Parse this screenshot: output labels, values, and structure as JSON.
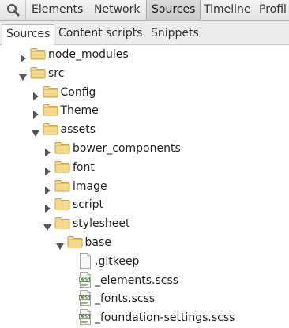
{
  "toolbar": {
    "search_icon": "magnifier-icon",
    "tabs": [
      {
        "label": "Elements"
      },
      {
        "label": "Network"
      },
      {
        "label": "Sources"
      },
      {
        "label": "Timeline"
      },
      {
        "label": "Profil"
      }
    ],
    "active_tab": "Sources"
  },
  "subtabs": {
    "items": [
      {
        "label": "Sources"
      },
      {
        "label": "Content scripts"
      },
      {
        "label": "Snippets"
      }
    ],
    "active": "Sources"
  },
  "tree": {
    "items": [
      {
        "label": "node_modules",
        "type": "folder",
        "expanded": false,
        "depth": 0
      },
      {
        "label": "src",
        "type": "folder",
        "expanded": true,
        "depth": 0
      },
      {
        "label": "Config",
        "type": "folder",
        "expanded": false,
        "depth": 1
      },
      {
        "label": "Theme",
        "type": "folder",
        "expanded": false,
        "depth": 1
      },
      {
        "label": "assets",
        "type": "folder",
        "expanded": true,
        "depth": 1
      },
      {
        "label": "bower_components",
        "type": "folder",
        "expanded": false,
        "depth": 2
      },
      {
        "label": "font",
        "type": "folder",
        "expanded": false,
        "depth": 2
      },
      {
        "label": "image",
        "type": "folder",
        "expanded": false,
        "depth": 2
      },
      {
        "label": "script",
        "type": "folder",
        "expanded": false,
        "depth": 2
      },
      {
        "label": "stylesheet",
        "type": "folder",
        "expanded": true,
        "depth": 2
      },
      {
        "label": "base",
        "type": "folder",
        "expanded": true,
        "depth": 3
      },
      {
        "label": ".gitkeep",
        "type": "file",
        "icon": "blank-file-icon",
        "depth": 4
      },
      {
        "label": "_elements.scss",
        "type": "file",
        "icon": "css-file-icon",
        "depth": 4
      },
      {
        "label": "_fonts.scss",
        "type": "file",
        "icon": "css-file-icon",
        "depth": 4
      },
      {
        "label": "_foundation-settings.scss",
        "type": "file",
        "icon": "css-file-icon",
        "depth": 4
      }
    ]
  },
  "colors": {
    "folder_fill": "#f4d98a",
    "folder_stroke": "#c9a550",
    "arrow": "#555555",
    "css_badge": "#6b8f5a"
  }
}
